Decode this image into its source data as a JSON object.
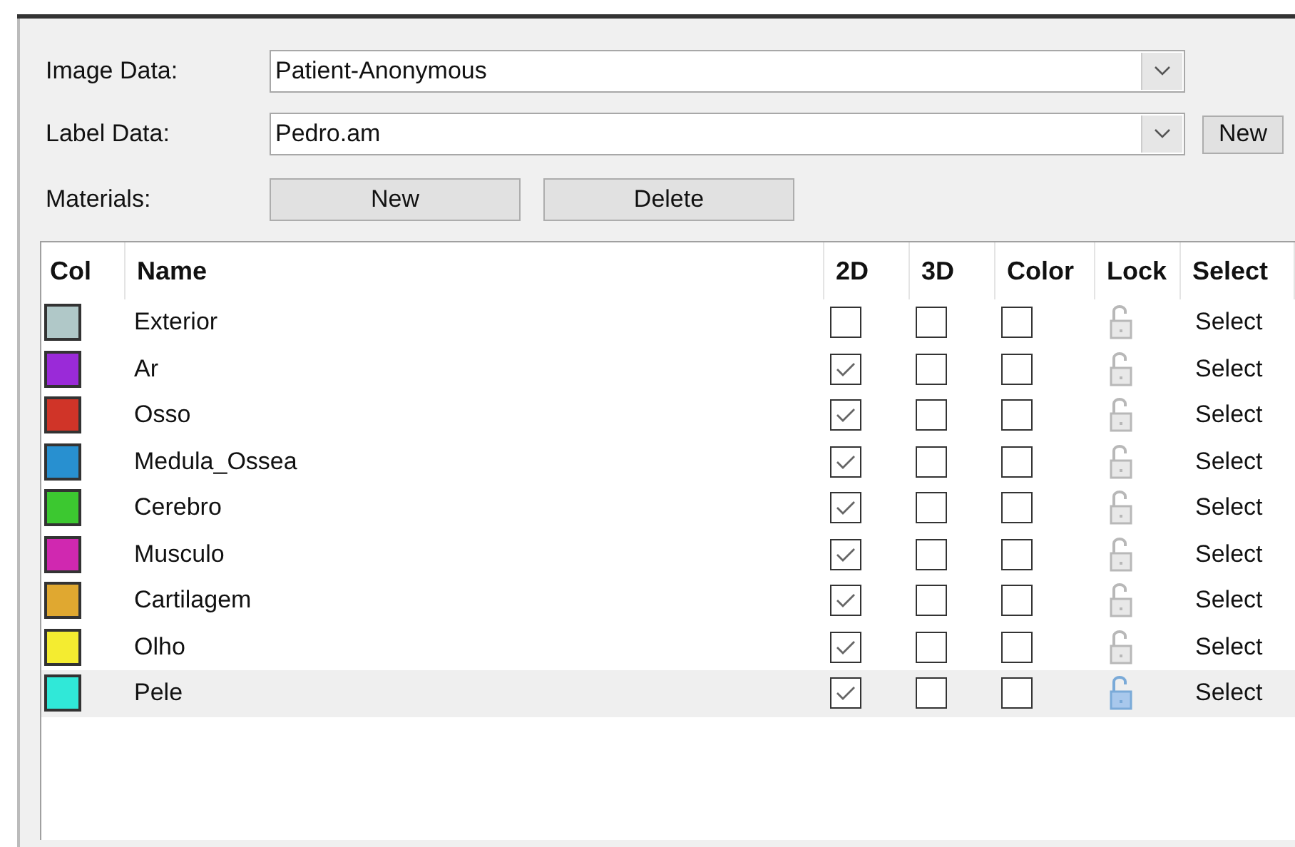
{
  "form": {
    "image_data": {
      "label": "Image Data:",
      "value": "Patient-Anonymous"
    },
    "label_data": {
      "label": "Label Data:",
      "value": "Pedro.am",
      "button": "New"
    },
    "materials": {
      "label": "Materials:",
      "buttons": [
        "New",
        "Delete"
      ]
    }
  },
  "table": {
    "columns": [
      "Col",
      "Name",
      "2D",
      "3D",
      "Color",
      "Lock",
      "Select"
    ],
    "rows": [
      {
        "color": "#b0c8c8",
        "name": "Exterior",
        "show_2d": false,
        "show_3d": false,
        "color_on": false,
        "select": "Select",
        "selected": false
      },
      {
        "color": "#9a2ad8",
        "name": "Ar",
        "show_2d": true,
        "show_3d": false,
        "color_on": false,
        "select": "Select",
        "selected": false
      },
      {
        "color": "#d03428",
        "name": "Osso",
        "show_2d": true,
        "show_3d": false,
        "color_on": false,
        "select": "Select",
        "selected": false
      },
      {
        "color": "#2890d0",
        "name": "Medula_Ossea",
        "show_2d": true,
        "show_3d": false,
        "color_on": false,
        "select": "Select",
        "selected": false
      },
      {
        "color": "#3cc830",
        "name": "Cerebro",
        "show_2d": true,
        "show_3d": false,
        "color_on": false,
        "select": "Select",
        "selected": false
      },
      {
        "color": "#d028b0",
        "name": "Musculo",
        "show_2d": true,
        "show_3d": false,
        "color_on": false,
        "select": "Select",
        "selected": false
      },
      {
        "color": "#e0a830",
        "name": "Cartilagem",
        "show_2d": true,
        "show_3d": false,
        "color_on": false,
        "select": "Select",
        "selected": false
      },
      {
        "color": "#f4ec30",
        "name": "Olho",
        "show_2d": true,
        "show_3d": false,
        "color_on": false,
        "select": "Select",
        "selected": false
      },
      {
        "color": "#30e8d8",
        "name": "Pele",
        "show_2d": true,
        "show_3d": false,
        "color_on": false,
        "select": "Select",
        "selected": true
      }
    ]
  }
}
